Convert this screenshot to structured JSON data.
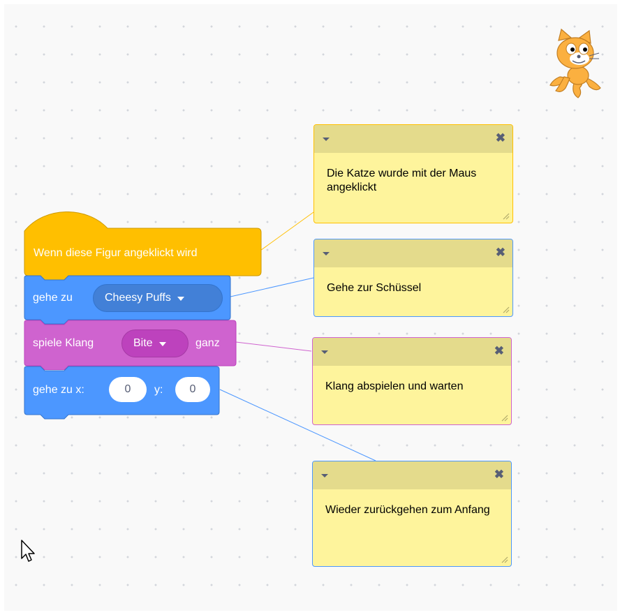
{
  "workspace": {
    "grid": "dotted"
  },
  "sprite": {
    "name": "cat-sprite-icon"
  },
  "script": {
    "hat": {
      "label": "Wenn diese Figur angeklickt wird",
      "color": "#ffbf00",
      "border": "#cc9900"
    },
    "goto_block": {
      "label": "gehe zu",
      "target": "Cheesy Puffs",
      "color": "#4c97ff",
      "dark": "#4280d7",
      "border": "#3373cc"
    },
    "sound_block": {
      "label": "spiele Klang",
      "sound": "Bite",
      "suffix": "ganz",
      "color": "#cf63cf",
      "dark": "#bd42bd",
      "border": "#bd42bd"
    },
    "gotoxy_block": {
      "label": "gehe zu x:",
      "x": "0",
      "y_label": "y:",
      "y": "0",
      "color": "#4c97ff",
      "border": "#3373cc"
    }
  },
  "comments": [
    {
      "text": "Die Katze wurde mit der Maus angeklickt",
      "border": "#ffbf00"
    },
    {
      "text": "Gehe zur Schüssel",
      "border": "#4c97ff"
    },
    {
      "text": "Klang abspielen und warten",
      "border": "#cf63cf"
    },
    {
      "text": "Wieder zurückgehen zum Anfang",
      "border": "#4c97ff"
    }
  ],
  "comment_controls": {
    "collapse_icon": "triangle-down-icon",
    "close_icon": "close-icon",
    "close_glyph": "✖",
    "resize_icon": "resize-grip-icon"
  },
  "cursor": {
    "icon": "mouse-pointer-icon"
  }
}
